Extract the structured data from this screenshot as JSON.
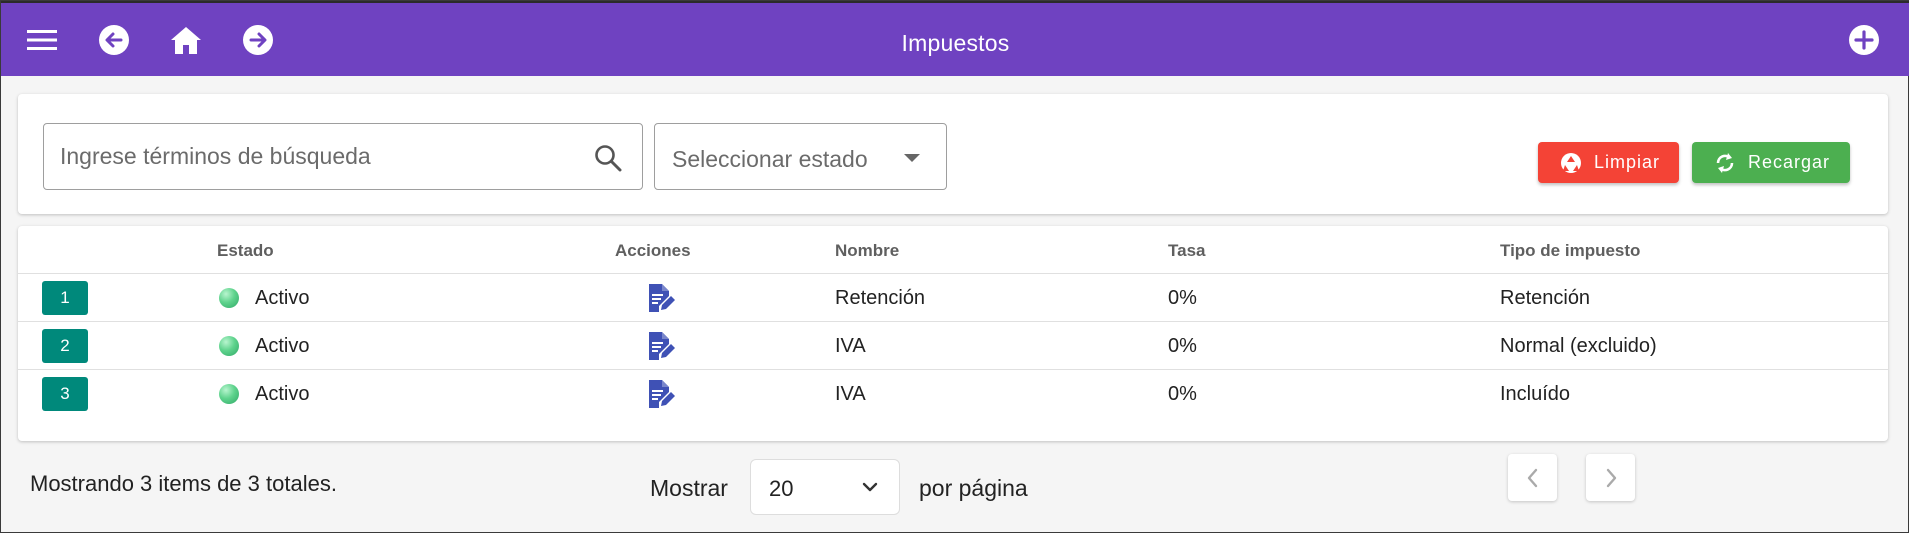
{
  "header": {
    "title": "Impuestos",
    "color": "#6f42c1",
    "icons": [
      "menu-icon",
      "arrow-left-circle-icon",
      "home-icon",
      "arrow-right-circle-icon",
      "plus-circle-icon"
    ]
  },
  "filters": {
    "search_placeholder": "Ingrese términos de búsqueda",
    "state_placeholder": "Seleccionar estado",
    "clear_label": "Limpiar",
    "reload_label": "Recargar",
    "clear_color": "#f44336",
    "reload_color": "#4caf50"
  },
  "table": {
    "columns": [
      "",
      "Estado",
      "Acciones",
      "Nombre",
      "Tasa",
      "Tipo de impuesto"
    ],
    "rows": [
      {
        "num": "1",
        "estado": "Activo",
        "nombre": "Retención",
        "tasa": "0%",
        "tipo": "Retención"
      },
      {
        "num": "2",
        "estado": "Activo",
        "nombre": "IVA",
        "tasa": "0%",
        "tipo": "Normal (excluido)"
      },
      {
        "num": "3",
        "estado": "Activo",
        "nombre": "IVA",
        "tasa": "0%",
        "tipo": "Incluído"
      }
    ],
    "badge_color": "#00897b",
    "active_color": "#5fd38d"
  },
  "footer": {
    "summary": "Mostrando 3 items de 3 totales.",
    "show_label": "Mostrar",
    "per_page_value": "20",
    "per_page_label": "por página"
  }
}
